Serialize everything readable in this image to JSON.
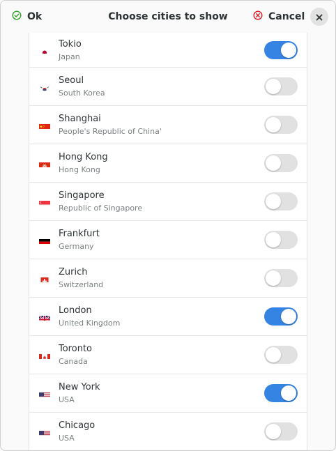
{
  "header": {
    "ok_label": "Ok",
    "title": "Choose cities to show",
    "cancel_label": "Cancel"
  },
  "colors": {
    "accent": "#3584e4",
    "ok_icon": "#33a02c",
    "cancel_icon": "#e01b24"
  },
  "cities": [
    {
      "city": "Tokio",
      "country": "Japan",
      "flag": "flag-japan-icon",
      "enabled": true
    },
    {
      "city": "Seoul",
      "country": "South Korea",
      "flag": "flag-south-korea-icon",
      "enabled": false
    },
    {
      "city": "Shanghai",
      "country": "People's Republic of China'",
      "flag": "flag-china-icon",
      "enabled": false
    },
    {
      "city": "Hong Kong",
      "country": "Hong Kong",
      "flag": "flag-hong-kong-icon",
      "enabled": false
    },
    {
      "city": "Singapore",
      "country": "Republic of Singapore",
      "flag": "flag-singapore-icon",
      "enabled": false
    },
    {
      "city": "Frankfurt",
      "country": "Germany",
      "flag": "flag-germany-icon",
      "enabled": false
    },
    {
      "city": "Zurich",
      "country": "Switzerland",
      "flag": "flag-switzerland-icon",
      "enabled": false
    },
    {
      "city": "London",
      "country": "United Kingdom",
      "flag": "flag-united-kingdom-icon",
      "enabled": true
    },
    {
      "city": "Toronto",
      "country": "Canada",
      "flag": "flag-canada-icon",
      "enabled": false
    },
    {
      "city": "New York",
      "country": "USA",
      "flag": "flag-usa-icon",
      "enabled": true
    },
    {
      "city": "Chicago",
      "country": "USA",
      "flag": "flag-usa-icon",
      "enabled": false
    }
  ]
}
